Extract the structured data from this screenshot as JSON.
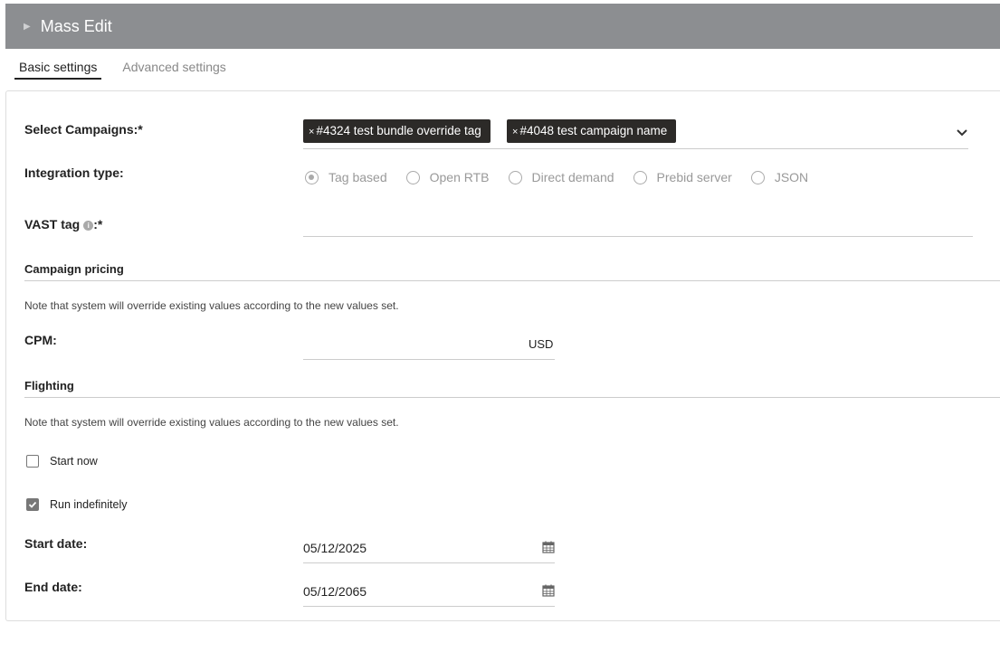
{
  "header": {
    "title": "Mass Edit",
    "collapse_icon": "triangle-right-icon"
  },
  "tabs": [
    {
      "label": "Basic settings",
      "active": true
    },
    {
      "label": "Advanced settings",
      "active": false
    }
  ],
  "form": {
    "campaigns": {
      "label": "Select Campaigns:*",
      "tags": [
        {
          "remove": "×",
          "text": "#4324 test bundle override tag"
        },
        {
          "remove": "×",
          "text": "#4048 test campaign name"
        }
      ]
    },
    "integration": {
      "label": "Integration type:",
      "options": [
        "Tag based",
        "Open RTB",
        "Direct demand",
        "Prebid server",
        "JSON"
      ],
      "selected": "Tag based"
    },
    "vast_tag": {
      "label": "VAST tag",
      "required": ":*",
      "value": ""
    },
    "pricing": {
      "title": "Campaign pricing",
      "note": "Note that system will override existing values according to the new values set.",
      "cpm_label": "CPM:",
      "cpm_value": "",
      "currency": "USD"
    },
    "flighting": {
      "title": "Flighting",
      "note": "Note that system will override existing values according to the new values set.",
      "start_now_label": "Start now",
      "start_now_checked": false,
      "run_indefinitely_label": "Run indefinitely",
      "run_indefinitely_checked": true,
      "start_date_label": "Start date:",
      "start_date": "05/12/2025",
      "end_date_label": "End date:",
      "end_date": "05/12/2065"
    }
  },
  "colors": {
    "header_bg": "#8c8e91",
    "tag_bg": "#2c2a28"
  }
}
